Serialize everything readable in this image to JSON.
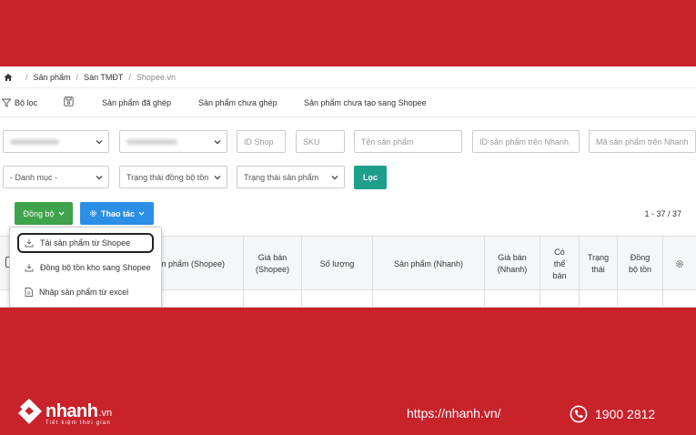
{
  "breadcrumb": {
    "items": [
      "Sản phẩm",
      "Sàn TMĐT",
      "Shopee.vn"
    ]
  },
  "tabs": {
    "filter": "Bộ lọc",
    "matched": "Sản phẩm đã ghép",
    "unmatched": "Sản phẩm chưa ghép",
    "not_created": "Sản phẩm chưa tạo sang Shopee"
  },
  "filters": {
    "shop_id": "ID Shop",
    "sku": "SKU",
    "product_name": "Tên sản phẩm",
    "nhanh_id": "ID sản phẩm trên Nhanh",
    "nhanh_code": "Mã sản phẩm trên Nhanh",
    "category": "- Danh mục -",
    "stock_sync_status": "Trạng thái đồng bộ tồn",
    "product_status": "Trạng thái sản phẩm",
    "filter_button": "Lọc"
  },
  "toolbar": {
    "sync_label": "Đồng bộ",
    "action_label": "Thao tác",
    "pager": "1 - 37 / 37"
  },
  "dropdown_menu": {
    "items": [
      "Tải sản phẩm từ Shopee",
      "Đồng bộ tồn kho sang Shopee",
      "Nhập sản phẩm từ excel"
    ]
  },
  "table": {
    "headers": {
      "product_shopee": "n phẩm (Shopee)",
      "price_shopee": "Giá bán\n(Shopee)",
      "quantity": "Số lượng",
      "product_nhanh": "Sản phẩm (Nhanh)",
      "price_nhanh": "Giá bán\n(Nhanh)",
      "sellable": "Có\nthể\nbán",
      "status": "Trạng\nthái",
      "stock_sync": "Đồng\nbộ tồn"
    }
  },
  "footer": {
    "brand": "nhanh",
    "brand_suffix": ".vn",
    "tagline": "Tiết kiệm thời gian",
    "url": "https://nhanh.vn/",
    "phone": "1900 2812"
  },
  "colors": {
    "background_red": "#c8222a",
    "sync_green": "#3ea34b",
    "action_blue": "#2b8fe6",
    "filter_teal": "#1f9e8c"
  },
  "icons": [
    "home-icon",
    "filter-icon",
    "save-icon",
    "gear-icon",
    "chevron-down-icon",
    "download-icon",
    "sync-icon",
    "file-icon",
    "phone-icon"
  ]
}
